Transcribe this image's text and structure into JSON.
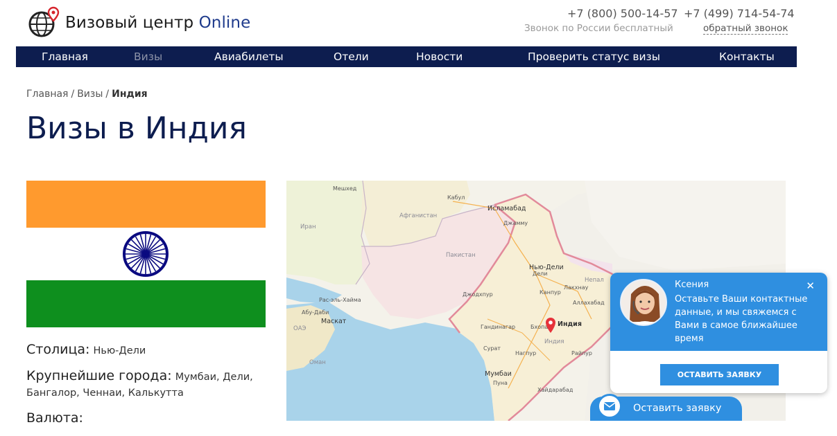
{
  "logo": {
    "text_main": "Визовый центр ",
    "text_accent": "Online"
  },
  "contacts": {
    "phone_free": "+7 (800) 500-14-57",
    "phone_moscow": "+7 (499) 714-54-74",
    "free_note": "Звонок по России бесплатный",
    "callback_label": "обратный звонок"
  },
  "nav": {
    "items": [
      {
        "label": "Главная"
      },
      {
        "label": "Визы"
      },
      {
        "label": "Авиабилеты"
      },
      {
        "label": "Отели"
      },
      {
        "label": "Новости"
      },
      {
        "label": "Проверить статус визы"
      },
      {
        "label": "Контакты"
      }
    ],
    "active": "Визы"
  },
  "breadcrumb": {
    "home": "Главная",
    "visas": "Визы",
    "separator": "/",
    "current": "Индия"
  },
  "page_title": "Визы в Индия",
  "facts": {
    "capital_label": "Столица:",
    "capital_value": "Нью-Дели",
    "cities_label": "Крупнейшие города:",
    "cities_value": "Мумбаи, Дели, Бангалор, Ченнаи, Калькутта",
    "currency_label": "Валюта:"
  },
  "map": {
    "countries": {
      "iran": "Иран",
      "afghanistan": "Афганистан",
      "pakistan": "Пакистан",
      "nepal": "Непал",
      "uae": "ОАЭ",
      "oman": "Оман",
      "india": "Индия"
    },
    "cities": {
      "mashhad": "Мешхед",
      "kabul": "Кабул",
      "islamabad": "Исламабад",
      "jammu": "Джамму",
      "newdelhi": "Нью-Дели",
      "delhi": "Дели",
      "lucknow": "Лакхнау",
      "allahabad": "Аллахабад",
      "kanpur": "Канпур",
      "jodhpur": "Джодхпур",
      "rasalkhaimah": "Рас-эль-Хайма",
      "abudhabi": "Абу-Даби",
      "muscat": "Маскат",
      "gandhinagar": "Гандинагар",
      "bhopal": "Бхопал",
      "surat": "Сурат",
      "mumbai": "Мумбаи",
      "pune": "Пуна",
      "hyderabad": "Хайдарабад",
      "raipur": "Райпур",
      "nagpur": "Нагпур",
      "marker_label": "Индия"
    }
  },
  "chat": {
    "agent_name": "Ксения",
    "message": "Оставьте Ваши контактные данные, и мы свяжемся с Вами в самое ближайшее время",
    "close_glyph": "✕",
    "button_label": "Оставить заявку",
    "bar_label": "Оставить заявку"
  },
  "colors": {
    "nav_bg": "#0d1d4f",
    "accent_blue": "#2f8fe0",
    "title_blue": "#0d1d4f",
    "flag_saffron": "#ff9a2e",
    "flag_green": "#0e8f1e",
    "chakra_navy": "#0a0a80"
  },
  "icons": {
    "logo": "globe-pin-icon",
    "map_marker": "map-pin-icon",
    "chat_close": "close-icon",
    "chat_bar": "envelope-icon"
  }
}
